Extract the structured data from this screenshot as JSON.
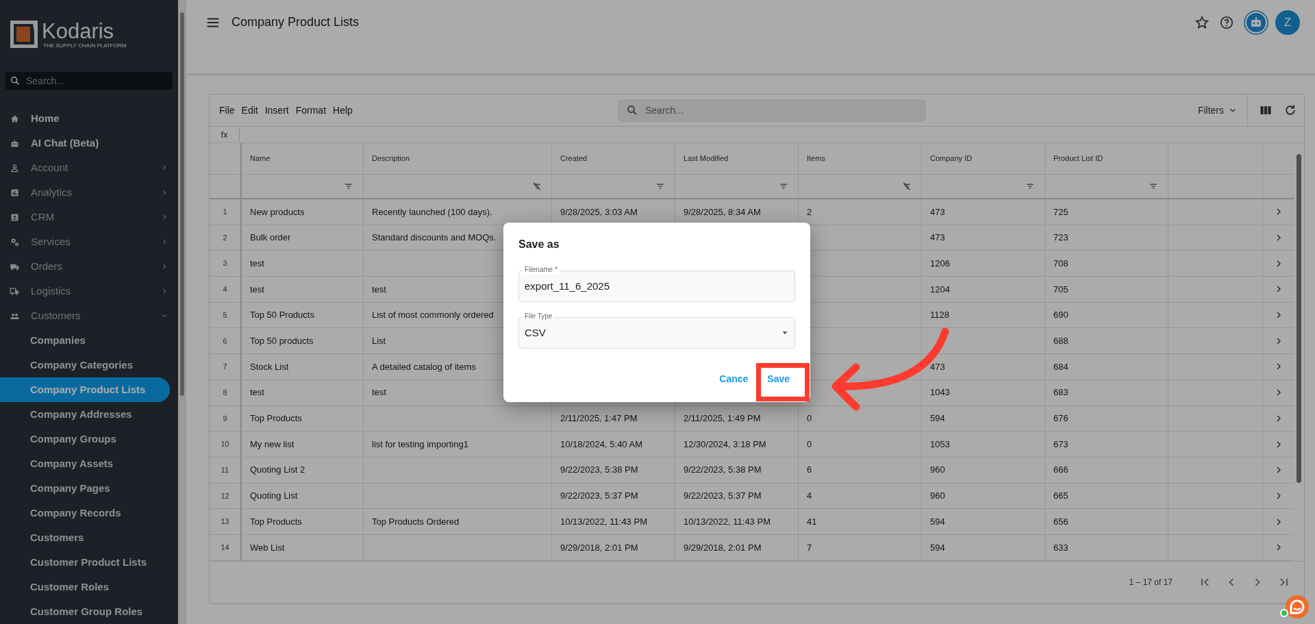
{
  "sidebar": {
    "logo": {
      "name": "Kodaris",
      "tagline": "THE SUPPLY CHAIN PLATFORM"
    },
    "search": {
      "placeholder": "Search..."
    },
    "items": [
      {
        "label": "Home",
        "selected": false
      },
      {
        "label": "AI Chat (Beta)",
        "selected": false
      },
      {
        "label": "Account",
        "selected": false,
        "expanded": false
      },
      {
        "label": "Analytics",
        "selected": false,
        "expanded": false
      },
      {
        "label": "CRM",
        "selected": false,
        "expanded": false
      },
      {
        "label": "Services",
        "selected": false,
        "expanded": false
      },
      {
        "label": "Orders",
        "selected": false,
        "expanded": false
      },
      {
        "label": "Logistics",
        "selected": false,
        "expanded": false
      },
      {
        "label": "Customers",
        "selected": false,
        "expanded": true,
        "children": [
          {
            "label": "Companies",
            "selected": false
          },
          {
            "label": "Company Categories",
            "selected": false
          },
          {
            "label": "Company Product Lists",
            "selected": true
          },
          {
            "label": "Company Addresses",
            "selected": false
          },
          {
            "label": "Company Groups",
            "selected": false
          },
          {
            "label": "Company Assets",
            "selected": false
          },
          {
            "label": "Company Pages",
            "selected": false
          },
          {
            "label": "Company Records",
            "selected": false
          },
          {
            "label": "Customers",
            "selected": false
          },
          {
            "label": "Customer Product Lists",
            "selected": false
          },
          {
            "label": "Customer Roles",
            "selected": false
          },
          {
            "label": "Customer Group Roles",
            "selected": false
          }
        ]
      }
    ]
  },
  "header": {
    "title": "Company Product Lists",
    "avatar": "Z"
  },
  "toolbar": {
    "menus": [
      "File",
      "Edit",
      "Insert",
      "Format",
      "Help"
    ],
    "search": {
      "placeholder": "Search..."
    },
    "filters": "Filters"
  },
  "formula_bar": {
    "label": "fx"
  },
  "table": {
    "columns": [
      {
        "label": "Name",
        "filter_cleared": false
      },
      {
        "label": "Description",
        "filter_cleared": true
      },
      {
        "label": "Created",
        "filter_cleared": false
      },
      {
        "label": "Last Modified",
        "filter_cleared": false
      },
      {
        "label": "Items",
        "filter_cleared": true
      },
      {
        "label": "Company ID",
        "filter_cleared": false
      },
      {
        "label": "Product List ID",
        "filter_cleared": false
      }
    ],
    "rows": [
      {
        "num": "1",
        "cells": [
          "New products",
          "Recently launched (100 days).",
          "9/28/2025, 3:03 AM",
          "9/28/2025, 8:34 AM",
          "2",
          "473",
          "725"
        ]
      },
      {
        "num": "2",
        "cells": [
          "Bulk order",
          "Standard discounts and MOQs.",
          null,
          null,
          null,
          "473",
          "723"
        ]
      },
      {
        "num": "3",
        "cells": [
          "test",
          null,
          null,
          null,
          null,
          "1206",
          "708"
        ]
      },
      {
        "num": "4",
        "cells": [
          "test",
          "test",
          null,
          null,
          null,
          "1204",
          "705"
        ]
      },
      {
        "num": "5",
        "cells": [
          "Top 50 Products",
          "List of most commonly ordered",
          null,
          null,
          null,
          "1128",
          "690"
        ]
      },
      {
        "num": "6",
        "cells": [
          "Top 50 products",
          "List",
          null,
          null,
          null,
          null,
          "688"
        ]
      },
      {
        "num": "7",
        "cells": [
          "Stock List",
          "A detailed catalog of items",
          null,
          null,
          null,
          "473",
          "684"
        ]
      },
      {
        "num": "8",
        "cells": [
          "test",
          "test",
          null,
          null,
          null,
          "1043",
          "683"
        ]
      },
      {
        "num": "9",
        "cells": [
          "Top Products",
          null,
          "2/11/2025, 1:47 PM",
          "2/11/2025, 1:49 PM",
          "0",
          "594",
          "676"
        ]
      },
      {
        "num": "10",
        "cells": [
          "My new list",
          "list for testing importing1",
          "10/18/2024, 5:40 AM",
          "12/30/2024, 3:18 PM",
          "0",
          "1053",
          "673"
        ]
      },
      {
        "num": "11",
        "cells": [
          "Quoting List 2",
          null,
          "9/22/2023, 5:38 PM",
          "9/22/2023, 5:38 PM",
          "6",
          "960",
          "666"
        ]
      },
      {
        "num": "12",
        "cells": [
          "Quoting List",
          null,
          "9/22/2023, 5:37 PM",
          "9/22/2023, 5:37 PM",
          "4",
          "960",
          "665"
        ]
      },
      {
        "num": "13",
        "cells": [
          "Top Products",
          "Top Products Ordered",
          "10/13/2022, 11:43 PM",
          "10/13/2022, 11:43 PM",
          "41",
          "594",
          "656"
        ]
      },
      {
        "num": "14",
        "cells": [
          "Web List",
          null,
          "9/29/2018, 2:01 PM",
          "9/29/2018, 2:01 PM",
          "7",
          "594",
          "633"
        ]
      }
    ]
  },
  "pagination": {
    "range": "1 – 17 of 17"
  },
  "dialog": {
    "title": "Save as",
    "fields": [
      {
        "kind": "text",
        "label": "Filename *",
        "value": "export_11_6_2025"
      },
      {
        "kind": "select",
        "label": "File Type",
        "value": "CSV"
      }
    ],
    "buttons": [
      "Cance",
      "Save"
    ]
  }
}
